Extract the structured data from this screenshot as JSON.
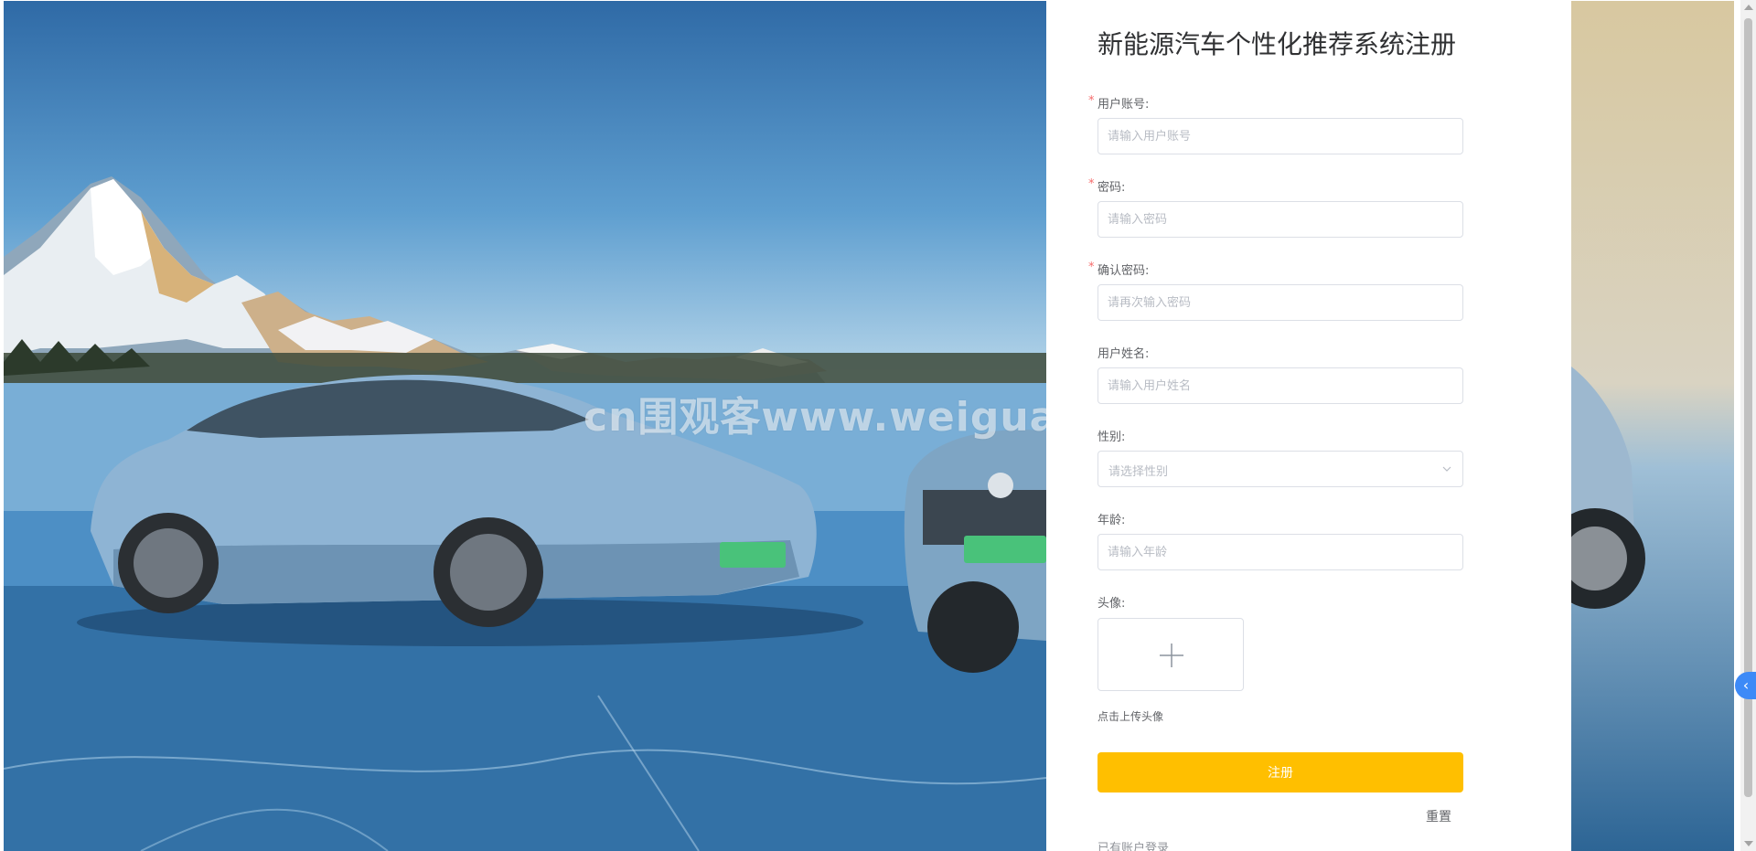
{
  "form": {
    "title": "新能源汽车个性化推荐系统注册",
    "required_mark": "*",
    "fields": {
      "account": {
        "label": "用户账号:",
        "placeholder": "请输入用户账号",
        "value": ""
      },
      "password": {
        "label": "密码:",
        "placeholder": "请输入密码",
        "value": ""
      },
      "confirm_password": {
        "label": "确认密码:",
        "placeholder": "请再次输入密码",
        "value": ""
      },
      "name": {
        "label": "用户姓名:",
        "placeholder": "请输入用户姓名",
        "value": ""
      },
      "gender": {
        "label": "性别:",
        "placeholder": "请选择性别"
      },
      "age": {
        "label": "年龄:",
        "placeholder": "请输入年龄",
        "value": ""
      },
      "avatar": {
        "label": "头像:",
        "tip": "点击上传头像"
      }
    },
    "register_label": "注册",
    "reset_label": "重置",
    "login_link": "已有账户登录"
  },
  "watermark": "cn围观客www.weiguanke.cn",
  "side_tab_icon": "chevron-left-icon",
  "colors": {
    "accent": "#ffbf00",
    "required": "#f56c6c",
    "border": "#dcdfe6",
    "side_tab": "#3d8af7"
  }
}
